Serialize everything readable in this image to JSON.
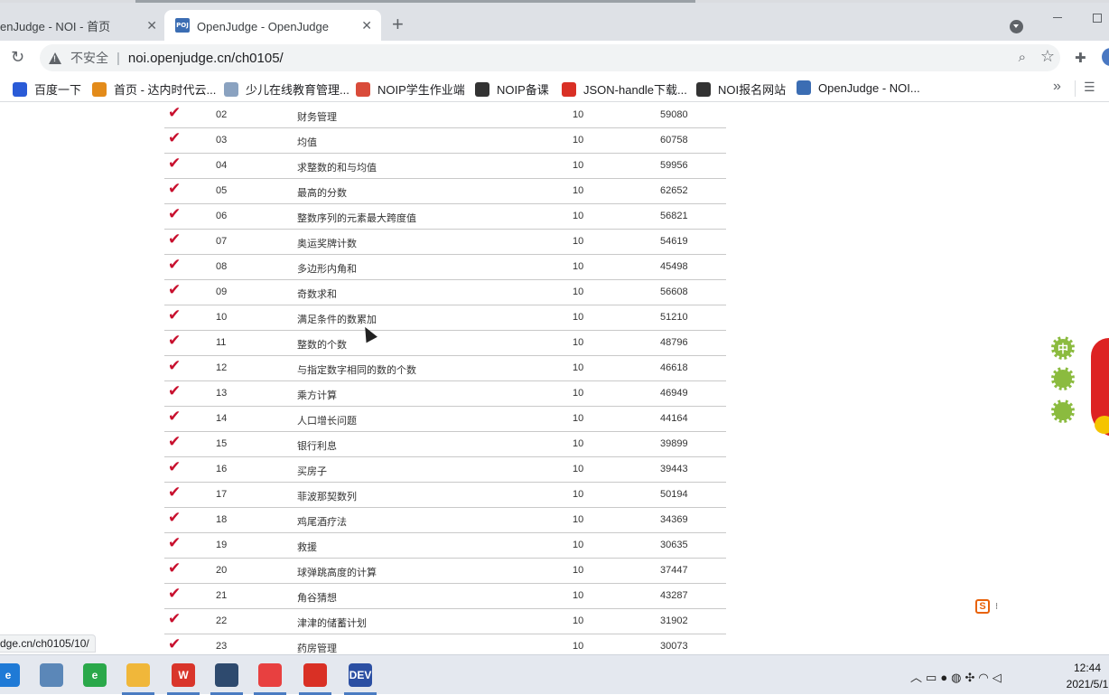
{
  "browser": {
    "tabs": [
      {
        "title": "enJudge - NOI - 首页",
        "active": false
      },
      {
        "title": "OpenJudge - OpenJudge - 题目",
        "active": true,
        "favicon_text": "POJ"
      }
    ],
    "new_tab": "+",
    "url_security": "不安全",
    "url": "noi.openjudge.cn/ch0105/",
    "bookmarks": [
      {
        "label": "百度一下",
        "icon": "baidu-paw-icon",
        "color": "#2a5bd7"
      },
      {
        "label": "首页 - 达内时代云...",
        "icon": "tarena-icon",
        "color": "#e38b1a"
      },
      {
        "label": "少儿在线教育管理...",
        "icon": "layers-icon",
        "color": "#8aa2c0"
      },
      {
        "label": "NOIP学生作业端",
        "icon": "grid-icon",
        "color": "#d94b3a"
      },
      {
        "label": "NOIP备课",
        "icon": "globe-icon",
        "color": "#333333"
      },
      {
        "label": "JSON-handle下载...",
        "icon": "c-logo-icon",
        "color": "#d93025"
      },
      {
        "label": "NOI报名网站",
        "icon": "globe-icon",
        "color": "#333333"
      },
      {
        "label": "OpenJudge - NOI...",
        "icon": "poj-icon",
        "color": "#3b6db3"
      }
    ],
    "status_url": "dge.cn/ch0105/10/"
  },
  "problems": [
    {
      "num": "02",
      "title": "财务管理",
      "score": "10",
      "accepted": "59080"
    },
    {
      "num": "03",
      "title": "均值",
      "score": "10",
      "accepted": "60758"
    },
    {
      "num": "04",
      "title": "求整数的和与均值",
      "score": "10",
      "accepted": "59956"
    },
    {
      "num": "05",
      "title": "最高的分数",
      "score": "10",
      "accepted": "62652"
    },
    {
      "num": "06",
      "title": "整数序列的元素最大跨度值",
      "score": "10",
      "accepted": "56821"
    },
    {
      "num": "07",
      "title": "奥运奖牌计数",
      "score": "10",
      "accepted": "54619"
    },
    {
      "num": "08",
      "title": "多边形内角和",
      "score": "10",
      "accepted": "45498"
    },
    {
      "num": "09",
      "title": "奇数求和",
      "score": "10",
      "accepted": "56608"
    },
    {
      "num": "10",
      "title": "满足条件的数累加",
      "score": "10",
      "accepted": "51210"
    },
    {
      "num": "11",
      "title": "整数的个数",
      "score": "10",
      "accepted": "48796"
    },
    {
      "num": "12",
      "title": "与指定数字相同的数的个数",
      "score": "10",
      "accepted": "46618"
    },
    {
      "num": "13",
      "title": "乘方计算",
      "score": "10",
      "accepted": "46949"
    },
    {
      "num": "14",
      "title": "人口增长问题",
      "score": "10",
      "accepted": "44164"
    },
    {
      "num": "15",
      "title": "银行利息",
      "score": "10",
      "accepted": "39899"
    },
    {
      "num": "16",
      "title": "买房子",
      "score": "10",
      "accepted": "39443"
    },
    {
      "num": "17",
      "title": "菲波那契数列",
      "score": "10",
      "accepted": "50194"
    },
    {
      "num": "18",
      "title": "鸡尾酒疗法",
      "score": "10",
      "accepted": "34369"
    },
    {
      "num": "19",
      "title": "救援",
      "score": "10",
      "accepted": "30635"
    },
    {
      "num": "20",
      "title": "球弹跳高度的计算",
      "score": "10",
      "accepted": "37447"
    },
    {
      "num": "21",
      "title": "角谷猜想",
      "score": "10",
      "accepted": "43287"
    },
    {
      "num": "22",
      "title": "津津的储蓄计划",
      "score": "10",
      "accepted": "31902"
    },
    {
      "num": "23",
      "title": "药房管理",
      "score": "10",
      "accepted": "30073"
    }
  ],
  "solved_mark": "✔",
  "decoration": {
    "flower_text": "中"
  },
  "ime": {
    "label": "S"
  },
  "taskbar": {
    "apps": [
      {
        "name": "edge",
        "color": "#1f7ad6",
        "text": "e"
      },
      {
        "name": "screen-tool",
        "color": "#5b87b8",
        "text": ""
      },
      {
        "name": "ie",
        "color": "#2aa84a",
        "text": "e"
      },
      {
        "name": "file-explorer",
        "color": "#f0b73a",
        "text": ""
      },
      {
        "name": "wps",
        "color": "#d9352b",
        "text": "W"
      },
      {
        "name": "classroom",
        "color": "#2e4a6e",
        "text": ""
      },
      {
        "name": "recorder",
        "color": "#e84040",
        "text": ""
      },
      {
        "name": "chrome",
        "color": "#d93025",
        "text": ""
      },
      {
        "name": "dev-cpp",
        "color": "#2b4fa3",
        "text": "DEV"
      }
    ],
    "clock_time": "12:44",
    "clock_date": "2021/5/1"
  }
}
